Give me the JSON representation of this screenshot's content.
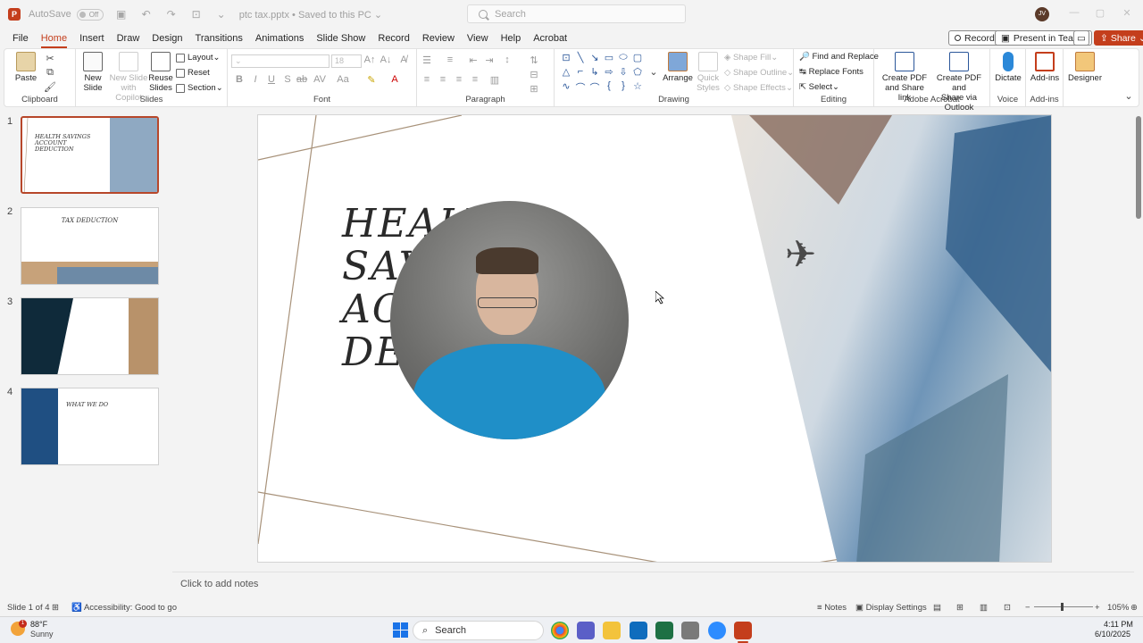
{
  "titlebar": {
    "autosave_label": "AutoSave",
    "autosave_state": "Off",
    "filename": "ptc tax.pptx",
    "save_status": "Saved to this PC",
    "search_placeholder": "Search",
    "user_initials": "JV"
  },
  "menu": {
    "tabs": [
      "File",
      "Home",
      "Insert",
      "Draw",
      "Design",
      "Transitions",
      "Animations",
      "Slide Show",
      "Record",
      "Review",
      "View",
      "Help",
      "Acrobat"
    ],
    "active_tab": "Home",
    "record_label": "Record",
    "present_label": "Present in Teams",
    "share_label": "Share"
  },
  "ribbon": {
    "clipboard": {
      "label": "Clipboard",
      "paste": "Paste"
    },
    "slides": {
      "label": "Slides",
      "new_slide_1": "New",
      "new_slide_2": "Slide",
      "copilot_1": "New Slide",
      "copilot_2": "with Copilot",
      "reuse_1": "Reuse",
      "reuse_2": "Slides",
      "layout": "Layout",
      "reset": "Reset",
      "section": "Section"
    },
    "font": {
      "label": "Font",
      "size": "18"
    },
    "paragraph": {
      "label": "Paragraph"
    },
    "drawing": {
      "label": "Drawing",
      "arrange": "Arrange",
      "quick_styles_1": "Quick",
      "quick_styles_2": "Styles",
      "shape_fill": "Shape Fill",
      "shape_outline": "Shape Outline",
      "shape_effects": "Shape Effects"
    },
    "editing": {
      "label": "Editing",
      "find_replace": "Find and Replace",
      "replace_fonts": "Replace Fonts",
      "select": "Select"
    },
    "acrobat": {
      "label": "Adobe Acrobat",
      "pdf_link_1": "Create PDF",
      "pdf_link_2": "and Share link",
      "pdf_outlook_1": "Create PDF and",
      "pdf_outlook_2": "Share via Outlook"
    },
    "voice": {
      "label": "Voice",
      "dictate": "Dictate"
    },
    "addins": {
      "label": "Add-ins",
      "addins_btn": "Add-ins"
    },
    "designer": {
      "label": "Designer"
    }
  },
  "thumbnails": [
    {
      "number": "1",
      "title": "HEALTH SAVINGS ACCOUNT DEDUCTION"
    },
    {
      "number": "2",
      "title": "TAX DEDUCTION"
    },
    {
      "number": "3",
      "title": ""
    },
    {
      "number": "4",
      "title": "WHAT WE DO"
    }
  ],
  "slide": {
    "title_lines": [
      "HEALT",
      "SAV",
      "AC",
      "DE"
    ]
  },
  "notes_placeholder": "Click to add notes",
  "statusbar": {
    "slide_count": "Slide 1 of 4",
    "accessibility": "Accessibility: Good to go",
    "notes": "Notes",
    "display_settings": "Display Settings",
    "zoom": "105%"
  },
  "taskbar": {
    "temperature": "88°F",
    "weather": "Sunny",
    "search": "Search",
    "time": "4:11 PM",
    "date": "6/10/2025",
    "weather_badge": "1"
  },
  "colors": {
    "accent": "#c43e1c",
    "selection_border": "#b7472a",
    "slide_line": "#a8927a"
  }
}
